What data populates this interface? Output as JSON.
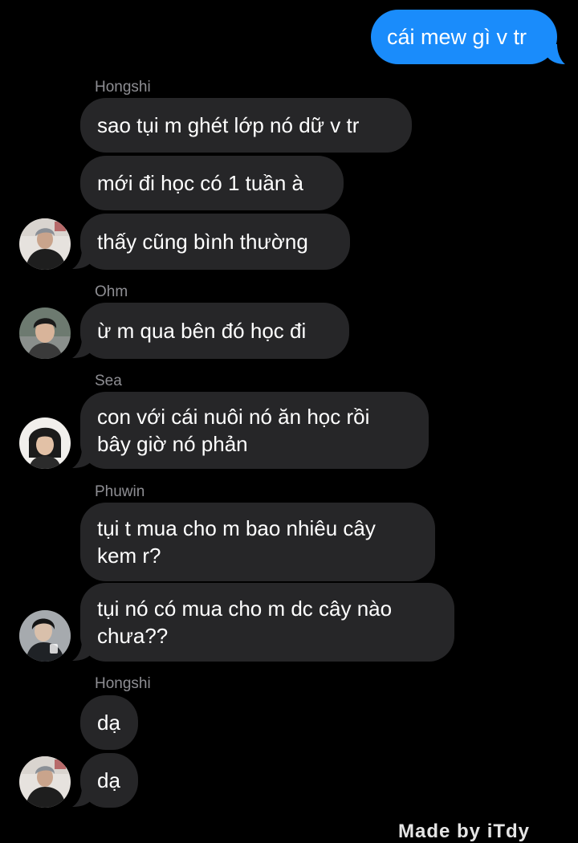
{
  "sent_message": {
    "text": "cái mew gì v tr",
    "color": "#1a8cfb"
  },
  "groups": [
    {
      "sender": "Hongshi",
      "messages": [
        "sao tụi m ghét lớp nó dữ v tr",
        "mới đi học có 1 tuần à",
        "thấy cũng bình thường"
      ]
    },
    {
      "sender": "Ohm",
      "messages": [
        "ừ m qua bên đó học đi"
      ]
    },
    {
      "sender": "Sea",
      "messages": [
        "con với cái nuôi nó ăn học rồi\nbây giờ nó phản"
      ]
    },
    {
      "sender": "Phuwin",
      "messages": [
        "tụi t mua cho m bao nhiêu cây\nkem r?",
        "tụi nó có mua cho m dc cây nào\nchưa??"
      ]
    },
    {
      "sender": "Hongshi",
      "messages": [
        "dạ",
        "dạ"
      ]
    }
  ],
  "received_bubble_color": "#262628",
  "sender_name_color": "#8e8e93",
  "footer_text_partial": "Made by iTdy"
}
